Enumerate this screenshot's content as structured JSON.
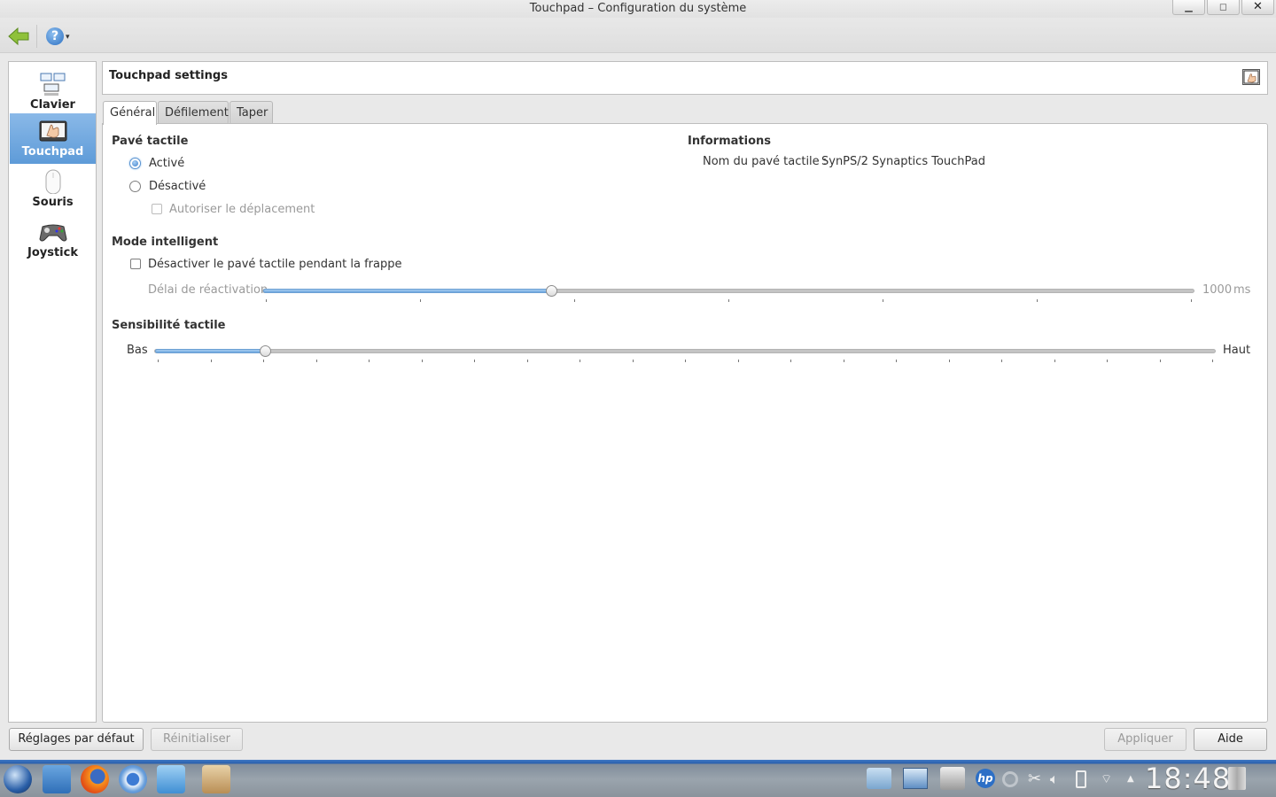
{
  "window": {
    "title": "Touchpad – Configuration du système",
    "minimize_glyph": "▁",
    "maximize_glyph": "◻",
    "close_glyph": "✕"
  },
  "toolbar": {
    "back_icon": "back-arrow-icon",
    "help_glyph": "?",
    "help_arrow": "▾"
  },
  "sidebar": {
    "items": [
      {
        "label": "Clavier",
        "icon": "keyboard-icon",
        "selected": false
      },
      {
        "label": "Touchpad",
        "icon": "touchpad-icon",
        "selected": true
      },
      {
        "label": "Souris",
        "icon": "mouse-icon",
        "selected": false
      },
      {
        "label": "Joystick",
        "icon": "joystick-icon",
        "selected": false
      }
    ]
  },
  "header": {
    "title": "Touchpad settings",
    "icon": "touchpad-icon"
  },
  "tabs": [
    {
      "label": "Général",
      "active": true
    },
    {
      "label": "Défilement",
      "active": false
    },
    {
      "label": "Taper",
      "active": false
    }
  ],
  "general": {
    "touchpad_group": {
      "title": "Pavé tactile",
      "enabled_label": "Activé",
      "disabled_label": "Désactivé",
      "allow_move_label": "Autoriser le déplacement",
      "enabled": true,
      "allow_move_checked": false,
      "allow_move_disabled": true
    },
    "info_group": {
      "title": "Informations",
      "name_label": "Nom du pavé tactile :",
      "name_value": "SynPS/2 Synaptics TouchPad"
    },
    "smart_group": {
      "title": "Mode intelligent",
      "disable_typing_label": "Désactiver le pavé tactile pendant la frappe",
      "disable_typing_checked": false,
      "delay_label": "Délai de réactivation",
      "delay_value": "1000",
      "delay_unit": "ms",
      "delay_fraction": 0.31
    },
    "sensitivity_group": {
      "title": "Sensibilité tactile",
      "low_label": "Bas",
      "high_label": "Haut",
      "sensitivity_fraction": 0.104
    }
  },
  "footer": {
    "defaults_label": "Réglages par défaut",
    "reset_label": "Réinitialiser",
    "apply_label": "Appliquer",
    "help_label": "Aide"
  },
  "taskbar": {
    "apps": [
      "launcher-icon",
      "file-manager-icon",
      "firefox-icon",
      "chromium-icon",
      "media-player-icon",
      "package-manager-icon"
    ],
    "tray": [
      "screenshot-icon",
      "workspace-icon",
      "system-settings-icon",
      "hp-icon",
      "update-icon",
      "scissors-icon",
      "volume-icon",
      "battery-icon",
      "wifi-icon",
      "tray-arrow-icon",
      "trash-icon"
    ],
    "clock": "18:48"
  }
}
